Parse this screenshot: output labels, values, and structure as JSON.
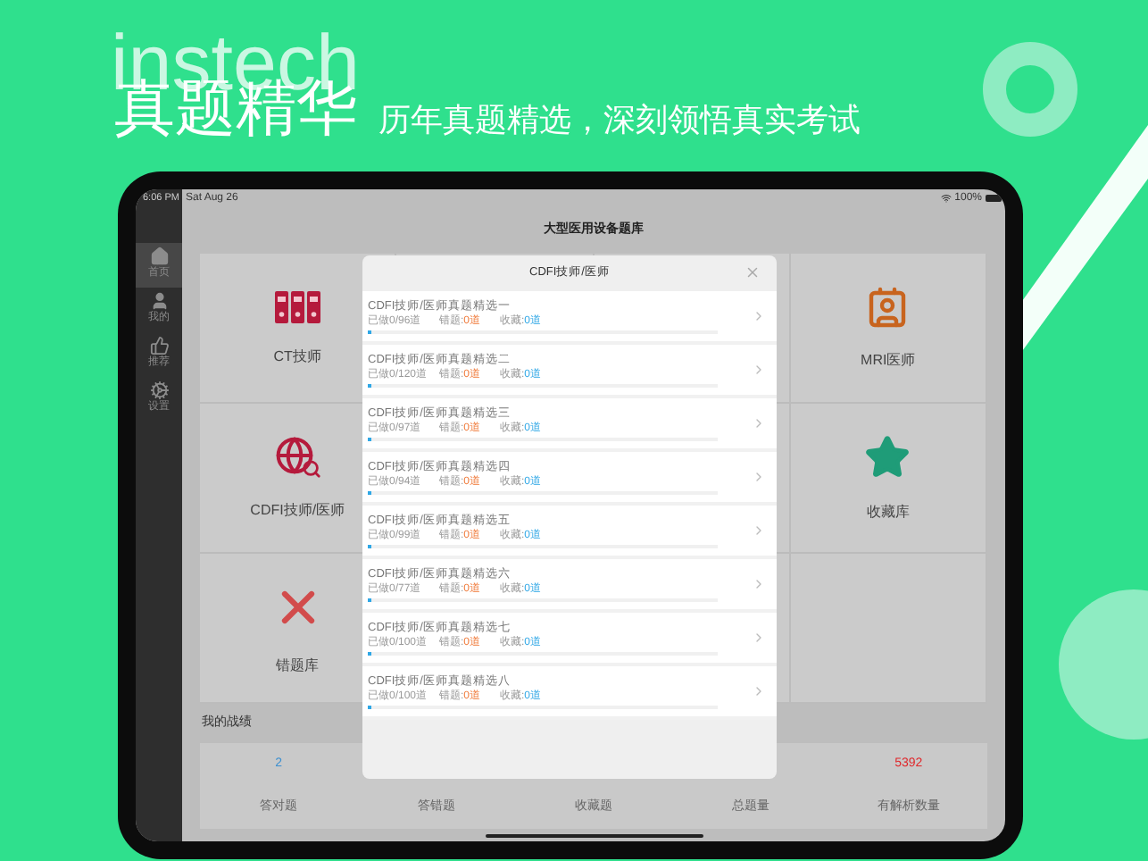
{
  "banner": {
    "watermark_word": "instech",
    "headline": "真题精华",
    "subtitle": "历年真题精选，深刻领悟真实考试"
  },
  "status_bar": {
    "time": "6:06 PM",
    "date": "Sat Aug 26",
    "battery": "100%"
  },
  "sidebar": {
    "items": [
      {
        "label": "首页",
        "selected": true
      },
      {
        "label": "我的",
        "selected": false
      },
      {
        "label": "推荐",
        "selected": false
      },
      {
        "label": "设置",
        "selected": false
      }
    ]
  },
  "app_title": "大型医用设备题库",
  "tiles": [
    {
      "label": "CT技师"
    },
    {
      "label": "MRI医师"
    },
    {
      "label": "CDFI技师/医师"
    },
    {
      "label": "收藏库"
    },
    {
      "label": "错题库"
    }
  ],
  "section_title": "我的战绩",
  "stats": [
    {
      "value": "2",
      "color": "#3b8fd0",
      "label": "答对题"
    },
    {
      "label": "答错题"
    },
    {
      "label": "收藏题"
    },
    {
      "label": "总题量"
    },
    {
      "value": "5392",
      "color": "#e0262a",
      "label": "有解析数量"
    }
  ],
  "modal": {
    "title": "CDFI技师/医师",
    "sets": [
      {
        "title": "CDFI技师/医师真题精选一",
        "done": "已做0/96道",
        "wrong_label": "错题:",
        "wrong_count": "0道",
        "fav_label": "收藏:",
        "fav_count": "0道",
        "level": 0.01
      },
      {
        "title": "CDFI技师/医师真题精选二",
        "done": "已做0/120道",
        "wrong_label": "错题:",
        "wrong_count": "0道",
        "fav_label": "收藏:",
        "fav_count": "0道",
        "level": 0.01
      },
      {
        "title": "CDFI技师/医师真题精选三",
        "done": "已做0/97道",
        "wrong_label": "错题:",
        "wrong_count": "0道",
        "fav_label": "收藏:",
        "fav_count": "0道",
        "level": 0.01
      },
      {
        "title": "CDFI技师/医师真题精选四",
        "done": "已做0/94道",
        "wrong_label": "错题:",
        "wrong_count": "0道",
        "fav_label": "收藏:",
        "fav_count": "0道",
        "level": 0.01
      },
      {
        "title": "CDFI技师/医师真题精选五",
        "done": "已做0/99道",
        "wrong_label": "错题:",
        "wrong_count": "0道",
        "fav_label": "收藏:",
        "fav_count": "0道",
        "level": 0.01
      },
      {
        "title": "CDFI技师/医师真题精选六",
        "done": "已做0/77道",
        "wrong_label": "错题:",
        "wrong_count": "0道",
        "fav_label": "收藏:",
        "fav_count": "0道",
        "level": 0.01
      },
      {
        "title": "CDFI技师/医师真题精选七",
        "done": "已做0/100道",
        "wrong_label": "错题:",
        "wrong_count": "0道",
        "fav_label": "收藏:",
        "fav_count": "0道",
        "level": 0.01
      },
      {
        "title": "CDFI技师/医师真题精选八",
        "done": "已做0/100道",
        "wrong_label": "错题:",
        "wrong_count": "0道",
        "fav_label": "收藏:",
        "fav_count": "0道",
        "level": 0.01
      }
    ]
  }
}
